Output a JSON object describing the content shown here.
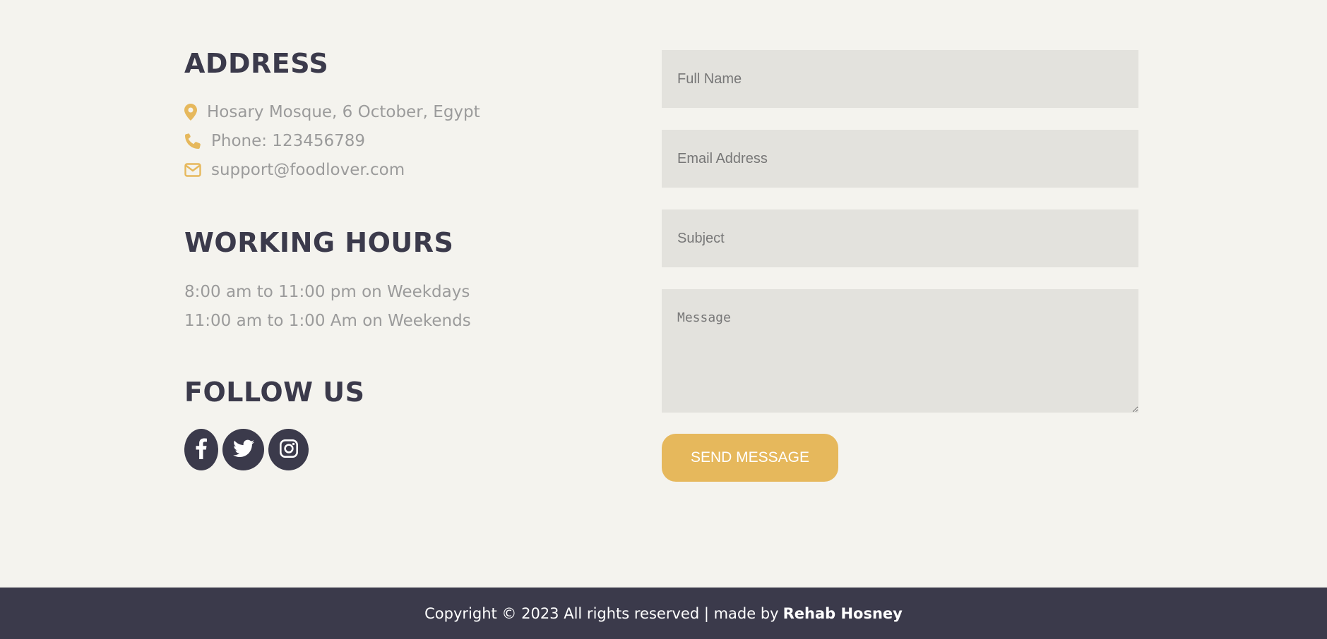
{
  "colors": {
    "background": "#f4f3ee",
    "heading": "#3b3a4b",
    "muted": "#9b9b9b",
    "accent": "#e6b85c",
    "field_bg": "#e3e2dd",
    "footer_bg": "#3b3a4b"
  },
  "address": {
    "heading": "ADDRESS",
    "location": {
      "icon": "map-pin-icon",
      "text": "Hosary Mosque, 6 October, Egypt"
    },
    "phone": {
      "icon": "phone-icon",
      "text": "Phone: 123456789"
    },
    "email": {
      "icon": "envelope-icon",
      "text": "support@foodlover.com"
    }
  },
  "hours": {
    "heading": "WORKING HOURS",
    "weekdays": "8:00 am to 11:00 pm on Weekdays",
    "weekends": "11:00 am to 1:00 Am on Weekends"
  },
  "follow": {
    "heading": "FOLLOW US",
    "links": [
      {
        "icon": "facebook-icon"
      },
      {
        "icon": "twitter-icon"
      },
      {
        "icon": "instagram-icon"
      }
    ]
  },
  "form": {
    "full_name_placeholder": "Full Name",
    "email_placeholder": "Email Address",
    "subject_placeholder": "Subject",
    "message_placeholder": "Message",
    "send_label": "SEND MESSAGE"
  },
  "footer": {
    "text": "Copyright © 2023 All rights reserved | made by",
    "author": "Rehab Hosney"
  }
}
